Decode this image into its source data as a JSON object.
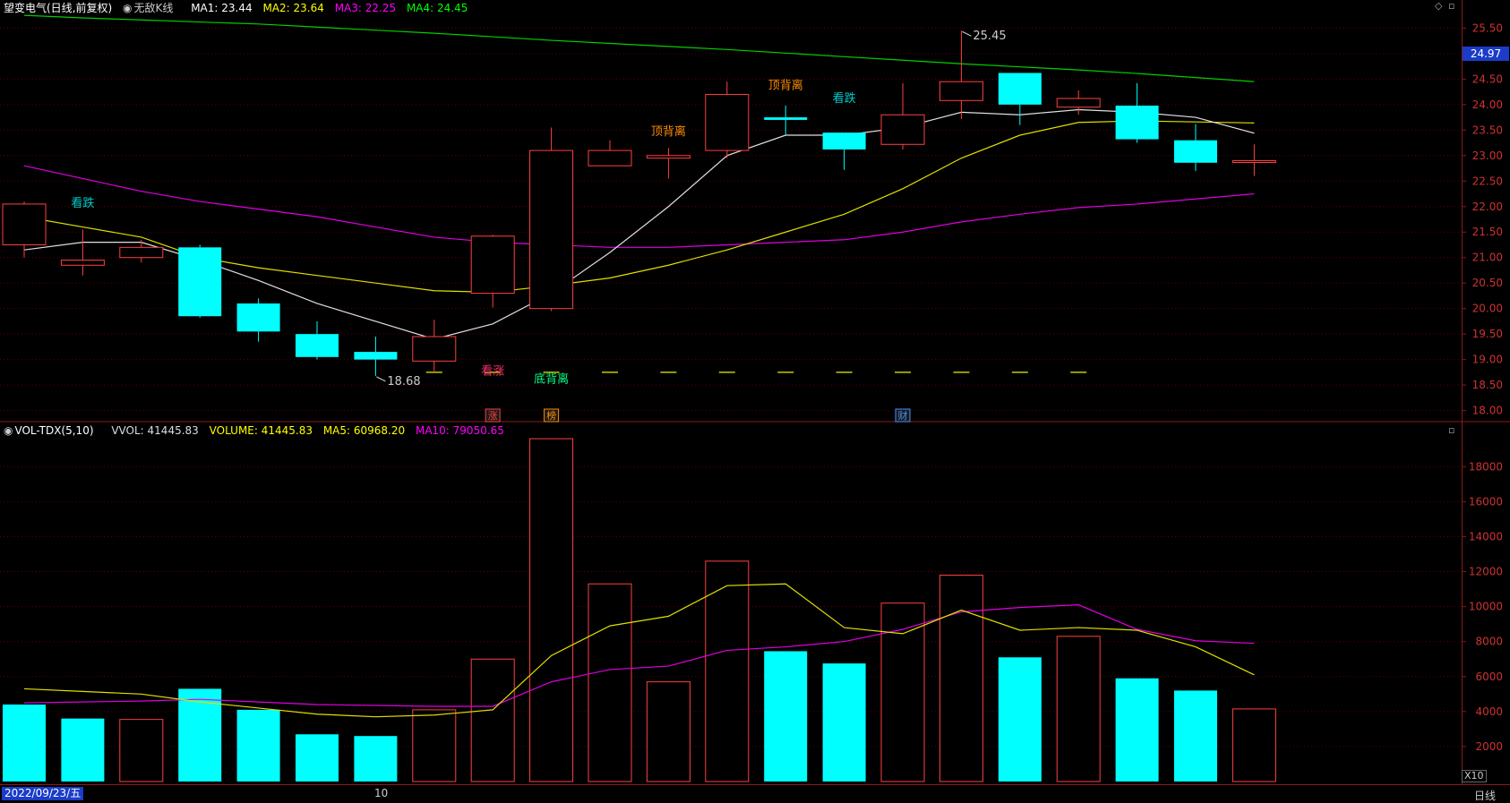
{
  "header": {
    "stock": "望变电气(日线,前复权)",
    "chart_mode": "无敌K线",
    "ma": [
      {
        "label": "MA1: 23.44",
        "color": "#ffffff"
      },
      {
        "label": "MA2: 23.64",
        "color": "#ffff00"
      },
      {
        "label": "MA3: 22.25",
        "color": "#ff00ff"
      },
      {
        "label": "MA4: 24.45",
        "color": "#00ff00"
      }
    ]
  },
  "volume_header": {
    "name": "VOL-TDX(5,10)",
    "vvol": "VVOL: 41445.83",
    "volume": "VOLUME: 41445.83",
    "ma5": "MA5: 60968.20",
    "ma10": "MA10: 79050.65"
  },
  "current_price": "24.97",
  "bottom": {
    "date": "2022/09/23/五",
    "tick": "10",
    "period": "日线",
    "scale": "X10"
  },
  "colors": {
    "up": "#ff4040",
    "down": "#00ffff",
    "grid": "#5a0000",
    "ma1": "#e0e0e0",
    "ma2": "#e0e000",
    "ma3": "#e000e0",
    "ma4": "#00d000"
  },
  "chart_data": [
    {
      "type": "candlestick",
      "ylim": [
        17.8,
        25.7
      ],
      "yticks": [
        "18.00",
        "18.50",
        "19.00",
        "19.50",
        "20.00",
        "20.50",
        "21.00",
        "21.50",
        "22.00",
        "22.50",
        "23.00",
        "23.50",
        "24.00",
        "24.50",
        "25.00",
        "25.50"
      ],
      "candles": [
        {
          "o": 21.25,
          "h": 22.1,
          "l": 21.0,
          "c": 22.05
        },
        {
          "o": 20.85,
          "h": 21.55,
          "l": 20.65,
          "c": 20.95
        },
        {
          "o": 21.0,
          "h": 21.35,
          "l": 20.9,
          "c": 21.2
        },
        {
          "o": 21.2,
          "h": 21.25,
          "l": 19.82,
          "c": 19.85
        },
        {
          "o": 20.1,
          "h": 20.2,
          "l": 19.35,
          "c": 19.55
        },
        {
          "o": 19.5,
          "h": 19.75,
          "l": 19.0,
          "c": 19.05
        },
        {
          "o": 19.15,
          "h": 19.45,
          "l": 18.68,
          "c": 19.0
        },
        {
          "o": 18.97,
          "h": 19.78,
          "l": 18.75,
          "c": 19.45
        },
        {
          "o": 20.3,
          "h": 21.45,
          "l": 20.02,
          "c": 21.42
        },
        {
          "o": 20.0,
          "h": 23.55,
          "l": 19.95,
          "c": 23.1
        },
        {
          "o": 22.8,
          "h": 23.3,
          "l": 22.8,
          "c": 23.1
        },
        {
          "o": 22.95,
          "h": 23.15,
          "l": 22.55,
          "c": 23.0
        },
        {
          "o": 23.1,
          "h": 24.45,
          "l": 22.95,
          "c": 24.2
        },
        {
          "o": 23.75,
          "h": 23.98,
          "l": 23.4,
          "c": 23.7
        },
        {
          "o": 23.45,
          "h": 23.45,
          "l": 22.72,
          "c": 23.12
        },
        {
          "o": 23.22,
          "h": 24.42,
          "l": 23.12,
          "c": 23.8
        },
        {
          "o": 24.08,
          "h": 25.45,
          "l": 23.72,
          "c": 24.45
        },
        {
          "o": 24.62,
          "h": 24.62,
          "l": 23.6,
          "c": 24.0
        },
        {
          "o": 23.95,
          "h": 24.28,
          "l": 23.8,
          "c": 24.12
        },
        {
          "o": 23.98,
          "h": 24.42,
          "l": 23.25,
          "c": 23.32
        },
        {
          "o": 23.3,
          "h": 23.62,
          "l": 22.7,
          "c": 22.86
        },
        {
          "o": 22.88,
          "h": 23.22,
          "l": 22.6,
          "c": 22.9
        }
      ],
      "ma1": [
        21.15,
        21.3,
        21.3,
        20.95,
        20.55,
        20.1,
        19.75,
        19.4,
        19.7,
        20.3,
        21.1,
        22.0,
        23.0,
        23.4,
        23.4,
        23.55,
        23.85,
        23.8,
        23.9,
        23.85,
        23.75,
        23.44
      ],
      "ma2": [
        21.8,
        21.6,
        21.4,
        21.0,
        20.8,
        20.65,
        20.5,
        20.35,
        20.32,
        20.45,
        20.6,
        20.85,
        21.15,
        21.5,
        21.85,
        22.35,
        22.95,
        23.4,
        23.65,
        23.68,
        23.66,
        23.64
      ],
      "ma3": [
        22.8,
        22.55,
        22.3,
        22.1,
        21.95,
        21.8,
        21.6,
        21.4,
        21.3,
        21.25,
        21.2,
        21.2,
        21.25,
        21.3,
        21.35,
        21.5,
        21.7,
        21.85,
        21.98,
        22.05,
        22.15,
        22.25
      ],
      "ma4": [
        25.75,
        25.7,
        25.66,
        25.62,
        25.58,
        25.52,
        25.46,
        25.4,
        25.33,
        25.26,
        25.2,
        25.14,
        25.08,
        25.01,
        24.94,
        24.87,
        24.8,
        24.74,
        24.68,
        24.61,
        24.53,
        24.45
      ],
      "labels": [
        {
          "i": 1,
          "text": "看跌",
          "color": "#00cccc",
          "pos": "above",
          "price": 22.0
        },
        {
          "i": 6,
          "text": "18.68",
          "color": "#cccccc",
          "pos": "low"
        },
        {
          "i": 8,
          "text": "看涨",
          "color": "#ff3070",
          "pos": "below",
          "price": 18.7
        },
        {
          "i": 9,
          "text": "底背离",
          "color": "#00ff88",
          "pos": "below",
          "price": 18.55
        },
        {
          "i": 11,
          "text": "顶背离",
          "color": "#ff8c00",
          "pos": "above",
          "price": 23.4
        },
        {
          "i": 13,
          "text": "顶背离",
          "color": "#ff8c00",
          "pos": "above",
          "price": 24.3
        },
        {
          "i": 14,
          "text": "看跌",
          "color": "#00cccc",
          "pos": "above",
          "price": 24.05
        },
        {
          "i": 16,
          "text": "25.45",
          "color": "#cccccc",
          "pos": "high"
        }
      ],
      "marks": [
        {
          "i": 8,
          "text": "涨",
          "color": "#ff4040"
        },
        {
          "i": 9,
          "text": "榜",
          "color": "#ff8c00"
        },
        {
          "i": 15,
          "text": "财",
          "color": "#4a90ff"
        }
      ],
      "signal_level": 18.75,
      "signal_range": [
        7,
        18
      ]
    },
    {
      "type": "bar",
      "ylim": [
        0,
        19500
      ],
      "yticks": [
        "2000",
        "4000",
        "6000",
        "8000",
        "10000",
        "12000",
        "14000",
        "16000",
        "18000"
      ],
      "values": [
        4400,
        3600,
        3550,
        5300,
        4100,
        2700,
        2600,
        4100,
        7000,
        19600,
        11300,
        5700,
        12600,
        7450,
        6750,
        10200,
        11800,
        7100,
        8300,
        5900,
        5200,
        4150
      ],
      "up": [
        false,
        false,
        true,
        false,
        false,
        false,
        false,
        true,
        true,
        true,
        true,
        true,
        true,
        false,
        false,
        true,
        true,
        false,
        true,
        false,
        false,
        true
      ],
      "ma5": [
        5300,
        5150,
        5000,
        4550,
        4200,
        3850,
        3700,
        3800,
        4100,
        7200,
        8900,
        9450,
        11200,
        11300,
        8800,
        8450,
        9800,
        8650,
        8800,
        8650,
        7700,
        6100
      ],
      "ma10": [
        4500,
        4550,
        4600,
        4700,
        4550,
        4400,
        4350,
        4300,
        4300,
        5700,
        6400,
        6600,
        7500,
        7700,
        8000,
        8700,
        9700,
        9950,
        10100,
        8700,
        8050,
        7900
      ]
    }
  ]
}
